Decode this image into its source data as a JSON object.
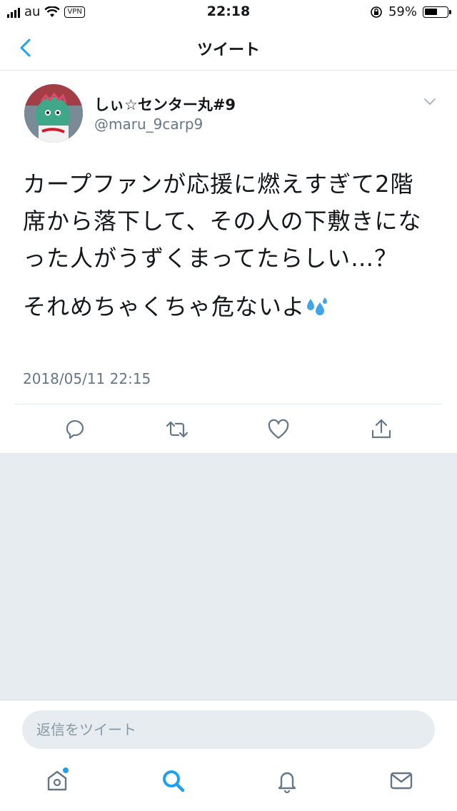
{
  "status_bar": {
    "carrier": "au",
    "vpn": "VPN",
    "time": "22:18",
    "battery": "59%",
    "battery_level": 0.59
  },
  "nav": {
    "title": "ツイート",
    "back_icon": "chevron-left-icon"
  },
  "tweet": {
    "display_name": "しぃ☆センター丸#9",
    "handle": "@maru_9carp9",
    "paragraph1": "カープファンが応援に燃えすぎて2階席から落下して、その人の下敷きになった人がうずくまってたらしい…？",
    "paragraph2": "それめちゃくちゃ危ないよ",
    "timestamp": "2018/05/11 22:15"
  },
  "actions": [
    "reply-icon",
    "retweet-icon",
    "like-icon",
    "share-icon"
  ],
  "reply_box": {
    "placeholder": "返信をツイート"
  },
  "tab_bar": [
    "home-icon",
    "search-icon",
    "notifications-icon",
    "messages-icon"
  ],
  "colors": {
    "accent": "#1da1f2",
    "text": "#14171a",
    "secondary": "#657786",
    "background_gray": "#e6ecf0"
  }
}
